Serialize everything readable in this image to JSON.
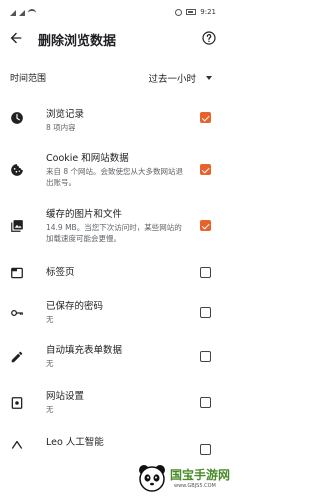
{
  "status_bar": {
    "time": "9:21"
  },
  "header": {
    "title": "删除浏览数据"
  },
  "time_range": {
    "label": "时间范围",
    "value": "过去一小时"
  },
  "items": [
    {
      "title": "浏览记录",
      "desc": "8 项内容",
      "checked": true,
      "icon": "clock-icon"
    },
    {
      "title": "Cookie 和网站数据",
      "desc": "来自 8 个网站。会致使您从大多数网站退出账号。",
      "checked": true,
      "icon": "cookie-icon"
    },
    {
      "title": "缓存的图片和文件",
      "desc": "14.9 MB。当您下次访问时，某些网站的加载速度可能会更慢。",
      "checked": true,
      "icon": "image-icon"
    },
    {
      "title": "标签页",
      "desc": "",
      "checked": false,
      "icon": "tab-icon"
    },
    {
      "title": "已保存的密码",
      "desc": "无",
      "checked": false,
      "icon": "key-icon"
    },
    {
      "title": "自动填充表单数据",
      "desc": "无",
      "checked": false,
      "icon": "pencil-icon"
    },
    {
      "title": "网站设置",
      "desc": "无",
      "checked": false,
      "icon": "site-settings-icon"
    },
    {
      "title": "Leo 人工智能",
      "desc": "",
      "checked": false,
      "icon": "leo-ai-icon"
    }
  ],
  "watermark": {
    "text": "国宝手游网",
    "url": "www.GBJS5.COM"
  },
  "colors": {
    "accent": "#e8622c",
    "text": "#202124",
    "secondary": "#5f6368"
  }
}
